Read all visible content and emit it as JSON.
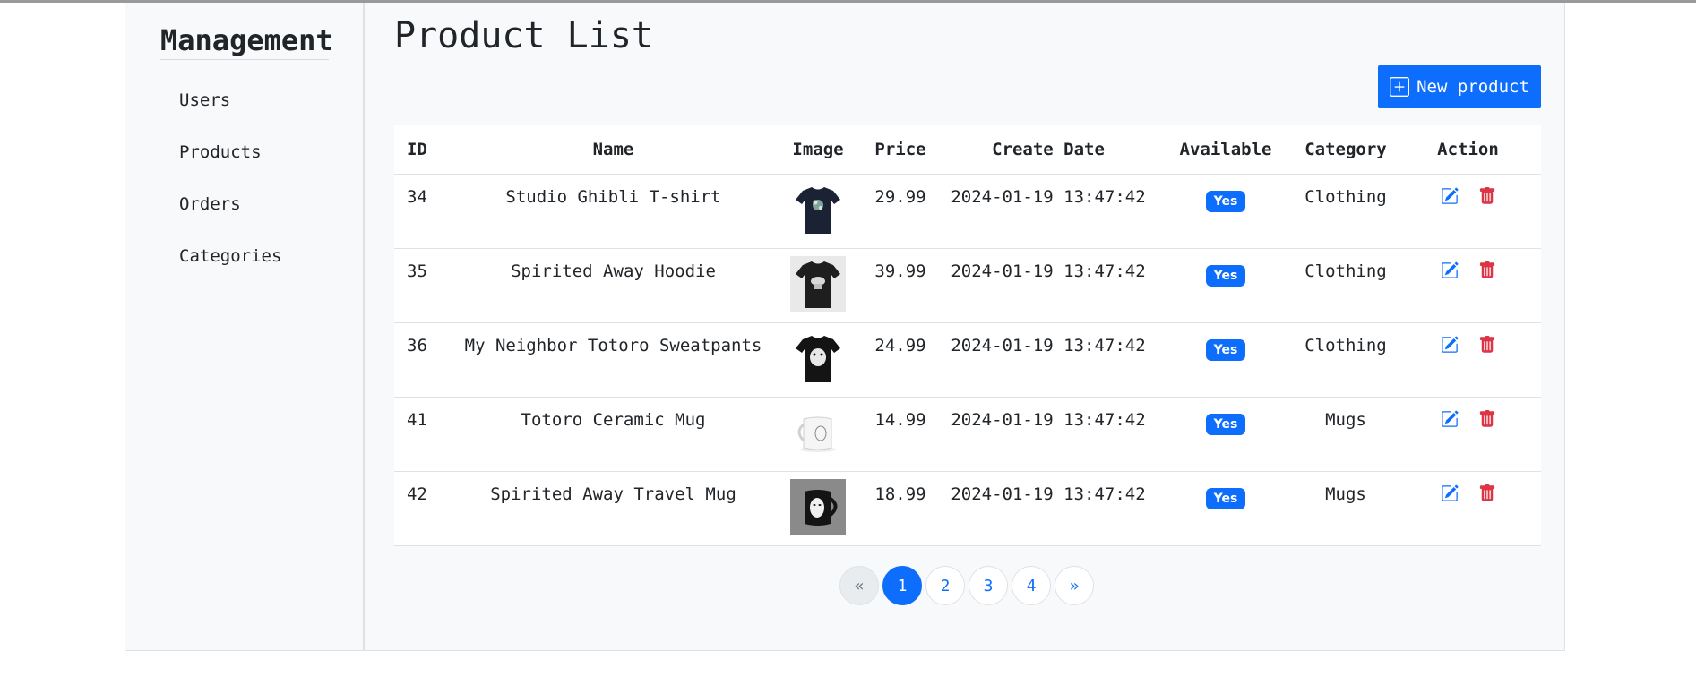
{
  "sidebar": {
    "title": "Management",
    "items": [
      {
        "label": "Users"
      },
      {
        "label": "Products"
      },
      {
        "label": "Orders"
      },
      {
        "label": "Categories"
      }
    ]
  },
  "main": {
    "title": "Product List",
    "new_button_label": "New product",
    "table": {
      "headers": [
        "ID",
        "Name",
        "Image",
        "Price",
        "Create Date",
        "Available",
        "Category",
        "Action"
      ],
      "rows": [
        {
          "id": "34",
          "name": "Studio Ghibli T-shirt",
          "image": "navy-tshirt-image",
          "price": "29.99",
          "date": "2024-01-19 13:47:42",
          "available": "Yes",
          "category": "Clothing"
        },
        {
          "id": "35",
          "name": "Spirited Away Hoodie",
          "image": "black-tshirt-image",
          "price": "39.99",
          "date": "2024-01-19 13:47:42",
          "available": "Yes",
          "category": "Clothing"
        },
        {
          "id": "36",
          "name": "My Neighbor Totoro Sweatpants",
          "image": "black-tshirt-totoro-image",
          "price": "24.99",
          "date": "2024-01-19 13:47:42",
          "available": "Yes",
          "category": "Clothing"
        },
        {
          "id": "41",
          "name": "Totoro Ceramic Mug",
          "image": "white-mug-image",
          "price": "14.99",
          "date": "2024-01-19 13:47:42",
          "available": "Yes",
          "category": "Mugs"
        },
        {
          "id": "42",
          "name": "Spirited Away Travel Mug",
          "image": "black-mug-image",
          "price": "18.99",
          "date": "2024-01-19 13:47:42",
          "available": "Yes",
          "category": "Mugs"
        }
      ]
    },
    "pagination": {
      "prev": "«",
      "pages": [
        "1",
        "2",
        "3",
        "4"
      ],
      "current": "1",
      "next": "»"
    }
  },
  "colors": {
    "primary": "#0d6efd",
    "danger": "#dc3545",
    "panel_bg": "#f8f9fa"
  },
  "icons": {
    "new": "plus-square-icon",
    "edit": "edit-icon",
    "delete": "trash-icon"
  }
}
